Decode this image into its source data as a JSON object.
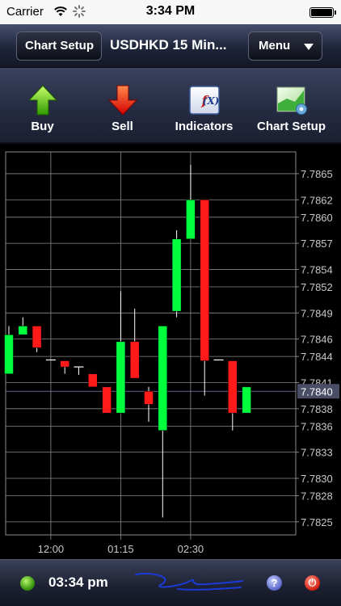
{
  "status_bar": {
    "carrier": "Carrier",
    "time": "3:34 PM"
  },
  "nav": {
    "back_label": "Chart Setup",
    "title": "USDHKD 15 Min...",
    "menu_label": "Menu"
  },
  "toolbar": {
    "items": [
      {
        "label": "Buy",
        "icon": "green-up-arrow-icon"
      },
      {
        "label": "Sell",
        "icon": "red-down-arrow-icon"
      },
      {
        "label": "Indicators",
        "icon": "function-fx-icon"
      },
      {
        "label": "Chart Setup",
        "icon": "chart-gear-icon"
      }
    ]
  },
  "colors": {
    "up": "#00ff3c",
    "down": "#ff1a1a",
    "grid": "#8a8a8a",
    "axis_text": "#c8c8c8",
    "current_price_bg": "#4a4d66"
  },
  "chart_data": {
    "type": "candlestick",
    "current_price": 7.784,
    "current_price_label": "7.7840",
    "ylim": [
      7.78235,
      7.78675
    ],
    "y_ticks": [
      "7.7865",
      "7.7862",
      "7.7860",
      "7.7857",
      "7.7854",
      "7.7852",
      "7.7849",
      "7.7846",
      "7.7844",
      "7.7841",
      "7.7838",
      "7.7836",
      "7.7833",
      "7.7830",
      "7.7828",
      "7.7825"
    ],
    "x_ticks": [
      "12:00",
      "01:15",
      "02:30"
    ],
    "x_tick_index": [
      3,
      8,
      13
    ],
    "candles": [
      {
        "o": 7.7842,
        "h": 7.78475,
        "l": 7.7842,
        "c": 7.78465
      },
      {
        "o": 7.78465,
        "h": 7.78485,
        "l": 7.78465,
        "c": 7.78475
      },
      {
        "o": 7.78475,
        "h": 7.78475,
        "l": 7.78445,
        "c": 7.7845
      },
      {
        "o": 7.78436,
        "h": 7.78436,
        "l": 7.78436,
        "c": 7.78436
      },
      {
        "o": 7.78435,
        "h": 7.78435,
        "l": 7.7842,
        "c": 7.78428
      },
      {
        "o": 7.78428,
        "h": 7.78428,
        "l": 7.78419,
        "c": 7.78428
      },
      {
        "o": 7.7842,
        "h": 7.7842,
        "l": 7.78405,
        "c": 7.78405
      },
      {
        "o": 7.78405,
        "h": 7.78405,
        "l": 7.78375,
        "c": 7.78375
      },
      {
        "o": 7.78375,
        "h": 7.78515,
        "l": 7.78375,
        "c": 7.78457
      },
      {
        "o": 7.78457,
        "h": 7.78495,
        "l": 7.78415,
        "c": 7.78415
      },
      {
        "o": 7.784,
        "h": 7.78405,
        "l": 7.78365,
        "c": 7.78385
      },
      {
        "o": 7.78355,
        "h": 7.78475,
        "l": 7.78255,
        "c": 7.78475
      },
      {
        "o": 7.78492,
        "h": 7.78585,
        "l": 7.78485,
        "c": 7.78575
      },
      {
        "o": 7.78575,
        "h": 7.7866,
        "l": 7.78575,
        "c": 7.7862
      },
      {
        "o": 7.7862,
        "h": 7.7862,
        "l": 7.78395,
        "c": 7.78435
      },
      {
        "o": 7.78436,
        "h": 7.78436,
        "l": 7.78436,
        "c": 7.78436
      },
      {
        "o": 7.78435,
        "h": 7.78435,
        "l": 7.78355,
        "c": 7.78375
      },
      {
        "o": 7.78375,
        "h": 7.78405,
        "l": 7.78375,
        "c": 7.78405
      }
    ]
  },
  "bottom_bar": {
    "time": "03:34 pm",
    "help_glyph": "?",
    "power_glyph": "⏻"
  }
}
